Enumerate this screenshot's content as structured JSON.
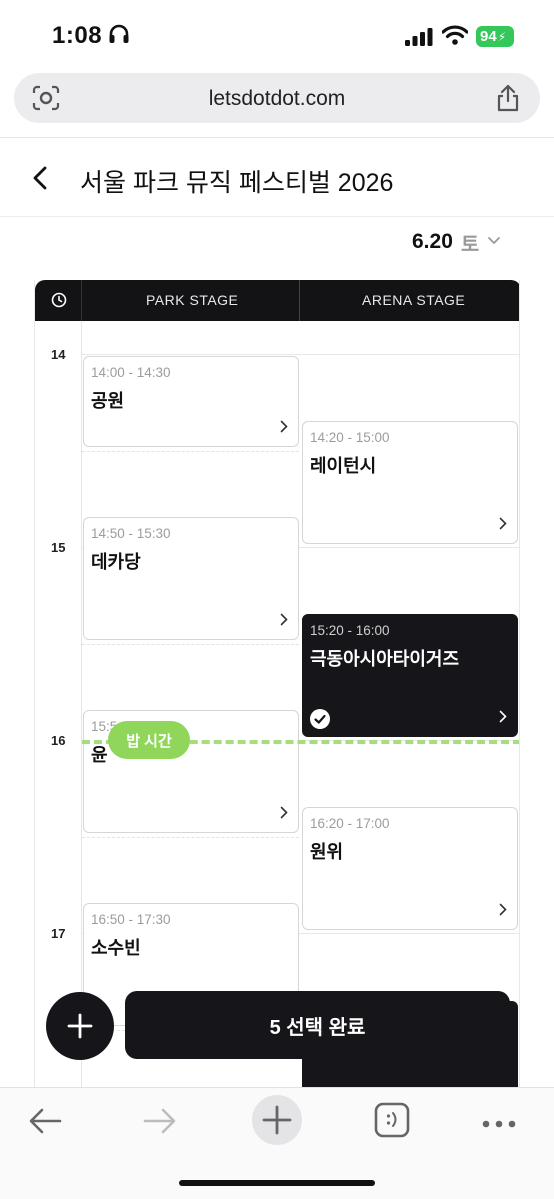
{
  "status_bar": {
    "time": "1:08",
    "battery": "94"
  },
  "browser": {
    "url": "letsdotdot.com"
  },
  "header": {
    "title": "서울 파크 뮤직 페스티벌 2026"
  },
  "date_selector": {
    "date": "6.20",
    "weekday": "토"
  },
  "timetable": {
    "columns": [
      "PARK STAGE",
      "ARENA STAGE"
    ],
    "hours": [
      "14",
      "15",
      "16",
      "17"
    ],
    "park_stage": [
      {
        "time": "14:00 - 14:30",
        "name": "공원",
        "selected": false
      },
      {
        "time": "14:50 - 15:30",
        "name": "데카당",
        "selected": false
      },
      {
        "time": "15:5",
        "name": "윤",
        "selected": false
      },
      {
        "time": "16:50 - 17:30",
        "name": "소수빈",
        "selected": false
      }
    ],
    "arena_stage": [
      {
        "time": "14:20 - 15:00",
        "name": "레이턴시",
        "selected": false
      },
      {
        "time": "15:20 - 16:00",
        "name": "극동아시아타이거즈",
        "selected": true
      },
      {
        "time": "16:20 - 17:00",
        "name": "원위",
        "selected": false
      }
    ],
    "meal_label": "밥 시간"
  },
  "actions": {
    "complete_label": "5 선택 완료"
  },
  "colors": {
    "accent_dark": "#16161a",
    "meal_green": "#8fd65a",
    "battery_green": "#34c759"
  },
  "icons": [
    "headphones-icon",
    "signal-icon",
    "wifi-icon",
    "lens-icon",
    "share-icon",
    "back-chevron-icon",
    "chevron-down-icon",
    "clock-icon",
    "chevron-right-icon",
    "check-icon",
    "plus-icon",
    "arrow-left-icon",
    "arrow-right-icon",
    "tabs-icon",
    "more-icon"
  ]
}
